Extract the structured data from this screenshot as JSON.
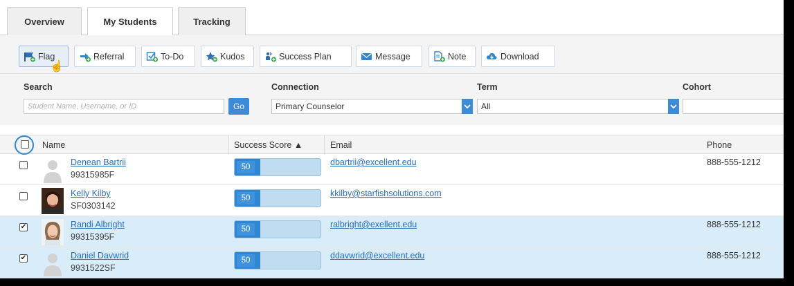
{
  "tabs": [
    {
      "label": "Overview"
    },
    {
      "label": "My Students"
    },
    {
      "label": "Tracking"
    }
  ],
  "toolbar": {
    "flag": "Flag",
    "referral": "Referral",
    "todo": "To-Do",
    "kudos": "Kudos",
    "success_plan": "Success Plan",
    "message": "Message",
    "note": "Note",
    "download": "Download"
  },
  "filters": {
    "search_label": "Search",
    "search_placeholder": "Student Name, Username, or ID",
    "go": "Go",
    "connection_label": "Connection",
    "connection_value": "Primary Counselor",
    "term_label": "Term",
    "term_value": "All",
    "cohort_label": "Cohort",
    "cohort_value": ""
  },
  "table": {
    "columns": {
      "name": "Name",
      "success_score": "Success Score ▲",
      "email": "Email",
      "phone": "Phone"
    },
    "rows": [
      {
        "name": "Denean Bartrii",
        "id": "99315985F",
        "score": "50",
        "score_fill": 0.3,
        "email": "dbartrii@excellent.edu",
        "phone": "888-555-1212",
        "checked": false,
        "selected": false,
        "avatar": "placeholder"
      },
      {
        "name": "Kelly Kilby",
        "id": "SF0303142",
        "score": "50",
        "score_fill": 0.3,
        "email": "kkilby@starfishsolutions.com",
        "phone": "",
        "checked": false,
        "selected": false,
        "avatar": "photo-dark-hair"
      },
      {
        "name": "Randi Albright",
        "id": "99315395F",
        "score": "50",
        "score_fill": 0.3,
        "email": "ralbright@exellent.edu",
        "phone": "888-555-1212",
        "checked": true,
        "selected": true,
        "avatar": "photo-light-hair"
      },
      {
        "name": "Daniel Davwrid",
        "id": "9931522SF",
        "score": "50",
        "score_fill": 0.3,
        "email": "ddavwrid@excellent.edu",
        "phone": "888-555-1212",
        "checked": true,
        "selected": true,
        "avatar": "placeholder"
      }
    ]
  },
  "colors": {
    "accent": "#3d8bd6",
    "link": "#2a6db5",
    "selected_row": "#d9ecf9",
    "score_fill": "#2f86d1",
    "score_track": "#bfdcf1"
  }
}
